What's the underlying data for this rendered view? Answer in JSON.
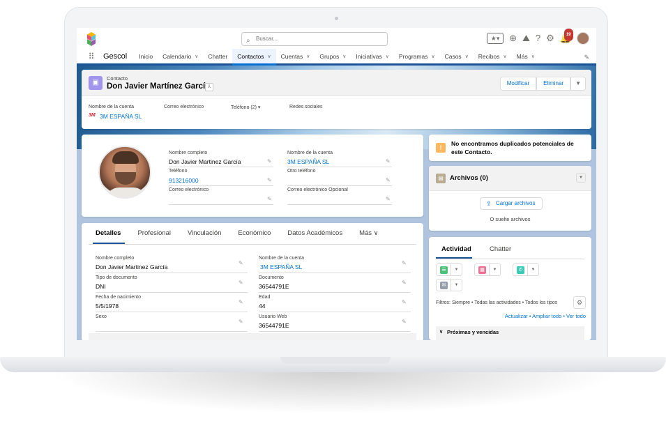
{
  "global_header": {
    "search_placeholder": "Buscar...",
    "notification_count": "19"
  },
  "nav": {
    "app_name": "Gescol",
    "items": [
      {
        "label": "Inicio",
        "has_menu": false,
        "active": false
      },
      {
        "label": "Calendario",
        "has_menu": true,
        "active": false
      },
      {
        "label": "Chatter",
        "has_menu": false,
        "active": false
      },
      {
        "label": "Contactos",
        "has_menu": true,
        "active": true
      },
      {
        "label": "Cuentas",
        "has_menu": true,
        "active": false
      },
      {
        "label": "Grupos",
        "has_menu": true,
        "active": false
      },
      {
        "label": "Iniciativas",
        "has_menu": true,
        "active": false
      },
      {
        "label": "Programas",
        "has_menu": true,
        "active": false
      },
      {
        "label": "Casos",
        "has_menu": true,
        "active": false
      },
      {
        "label": "Recibos",
        "has_menu": true,
        "active": false
      },
      {
        "label": "Más",
        "has_menu": true,
        "active": false
      }
    ]
  },
  "record": {
    "object_label": "Contacto",
    "name": "Don Javier Martínez García",
    "buttons": {
      "edit": "Modificar",
      "delete": "Eliminar"
    },
    "highlights": {
      "account_label": "Nombre de la cuenta",
      "account_logo": "3M",
      "account_value": "3M ESPAÑA SL",
      "email_label": "Correo electrónico",
      "phone_label": "Teléfono (2)",
      "social_label": "Redes sociales"
    }
  },
  "profile": {
    "full_name_label": "Nombre completo",
    "full_name": "Don Javier Martinez García",
    "phone_label": "Teléfono",
    "phone": "913216000",
    "email_label": "Correo electrónico",
    "account_label": "Nombre de la cuenta",
    "account": "3M ESPAÑA SL",
    "other_phone_label": "Otro teléfono",
    "alt_email_label": "Correo electrónico Opcional"
  },
  "duplicates": {
    "message": "No encontramos duplicados potenciales de este Contacto."
  },
  "files": {
    "title": "Archivos (0)",
    "upload_label": "Cargar archivos",
    "drop_text": "O suelte archivos"
  },
  "details": {
    "tabs": [
      "Detalles",
      "Profesional",
      "Vinculación",
      "Económico",
      "Datos Académicos",
      "Más"
    ],
    "fields_left": [
      {
        "label": "Nombre completo",
        "value": "Don Javier Martinez García"
      },
      {
        "label": "Tipo de documento",
        "value": "DNI"
      },
      {
        "label": "Fecha de nacimiento",
        "value": "5/5/1978"
      },
      {
        "label": "Sexo",
        "value": ""
      }
    ],
    "fields_right": [
      {
        "label": "Nombre de la cuenta",
        "value": "3M ESPAÑA SL"
      },
      {
        "label": "Documento",
        "value": "36544791E"
      },
      {
        "label": "Edad",
        "value": "44"
      },
      {
        "label": "Usuario Web",
        "value": "36544791E"
      }
    ]
  },
  "activity": {
    "tabs": [
      "Actividad",
      "Chatter"
    ],
    "action_colors": [
      "#4bc076",
      "#eb7092",
      "#3bc9b8",
      "#939ea8"
    ],
    "filters": "Filtros: Siempre • Todas las actividades • Todos los tipos",
    "links": "Actualizar • Ampliar todo • Ver todo",
    "upcoming": "Próximas y vencidas"
  }
}
